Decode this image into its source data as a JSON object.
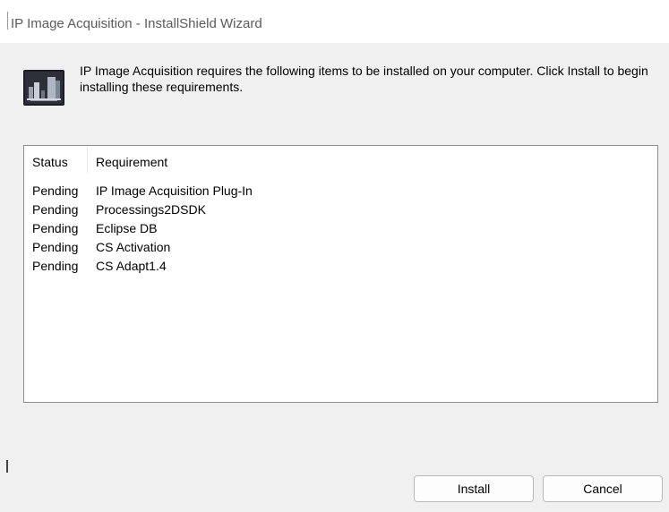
{
  "window": {
    "title": "IP Image Acquisition - InstallShield Wizard"
  },
  "header": {
    "icon": "installer-app-icon",
    "message": "IP Image Acquisition requires the following items to be installed on your computer. Click Install to begin installing these requirements."
  },
  "requirements": {
    "columns": {
      "status": "Status",
      "requirement": "Requirement"
    },
    "rows": [
      {
        "status": "Pending",
        "name": "IP Image Acquisition Plug-In"
      },
      {
        "status": "Pending",
        "name": "Processings2DSDK"
      },
      {
        "status": "Pending",
        "name": "Eclipse DB"
      },
      {
        "status": "Pending",
        "name": "CS Activation"
      },
      {
        "status": "Pending",
        "name": "CS Adapt1.4"
      }
    ]
  },
  "buttons": {
    "install": "Install",
    "cancel": "Cancel"
  },
  "colors": {
    "dialog_background": "#f0f0f0",
    "title_text": "#5b5b5b",
    "list_border": "#8e8e8e",
    "button_border": "#b9b9b9"
  }
}
